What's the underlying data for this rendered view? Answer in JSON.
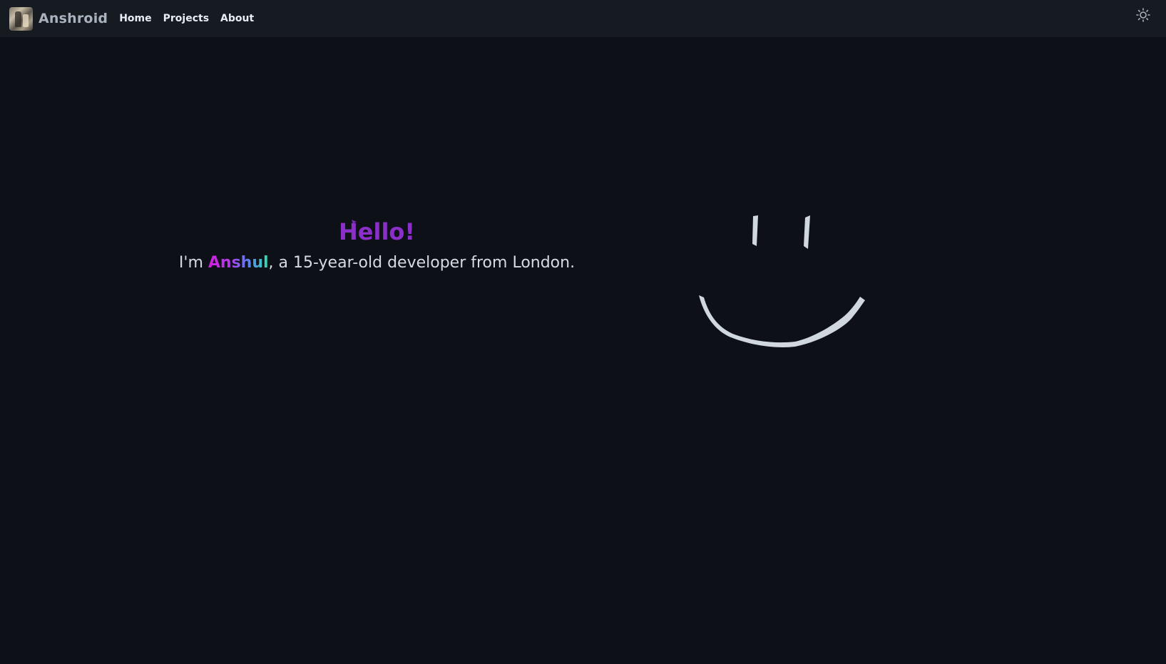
{
  "navbar": {
    "brand": "Anshroid",
    "avatar": "avatar-photo",
    "links": [
      {
        "label": "Home"
      },
      {
        "label": "Projects"
      },
      {
        "label": "About"
      }
    ],
    "theme_toggle_icon": "sun-icon"
  },
  "hero": {
    "heading": "Hello!",
    "intro_prefix": "I'm ",
    "name": "Anshul",
    "intro_suffix": ", a 15-year-old developer from London."
  },
  "illustration": {
    "icon": "smiley-face-drawing",
    "stroke_color": "#d0d7de"
  },
  "colors": {
    "background": "#0d1017",
    "navbar": "#161b22",
    "heading": "#8b2fc9",
    "text": "#d6dbe1"
  }
}
